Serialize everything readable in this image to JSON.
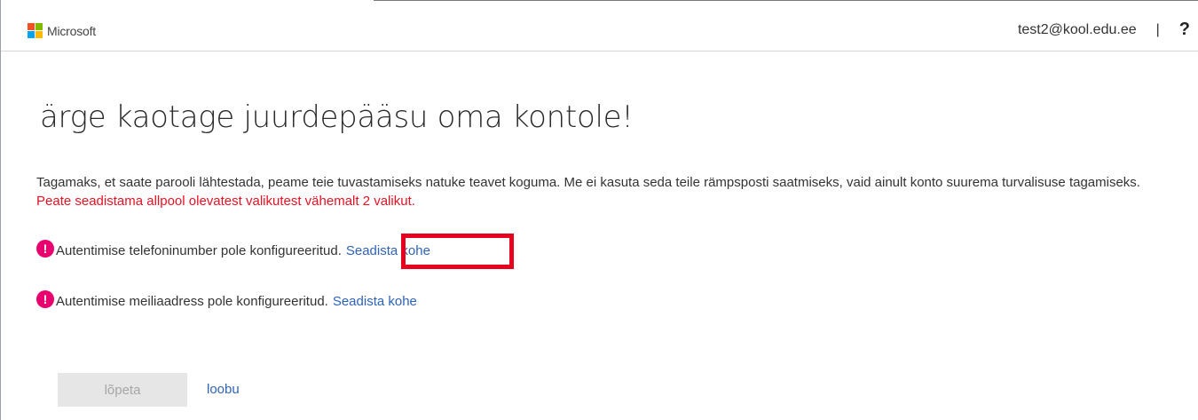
{
  "header": {
    "brand": "Microsoft",
    "user_email": "test2@kool.edu.ee",
    "separator": "|",
    "help_glyph": "?"
  },
  "main": {
    "title": "ärge kaotage juurdepääsu oma kontole!",
    "intro_text": "Tagamaks, et saate parooli lähtestada, peame teie tuvastamiseks natuke teavet koguma. Me ei kasuta seda teile rämpsposti saatmiseks, vaid ainult konto suurema turvalisuse tagamiseks.",
    "intro_warning": "Peate seadistama allpool olevatest valikutest vähemalt 2 valikut.",
    "methods": [
      {
        "icon": "alert-icon",
        "text": "Autentimise telefoninumber pole konfigureeritud.",
        "action": "Seadista kohe"
      },
      {
        "icon": "alert-icon",
        "text": "Autentimise meiliaadress pole konfigureeritud.",
        "action": "Seadista kohe"
      }
    ]
  },
  "footer": {
    "finish_label": "lõpeta",
    "cancel_label": "loobu"
  },
  "colors": {
    "link": "#2f63b8",
    "warning_text": "#e81123",
    "alert_icon": "#e8006f",
    "highlight_box": "#e8001f"
  }
}
